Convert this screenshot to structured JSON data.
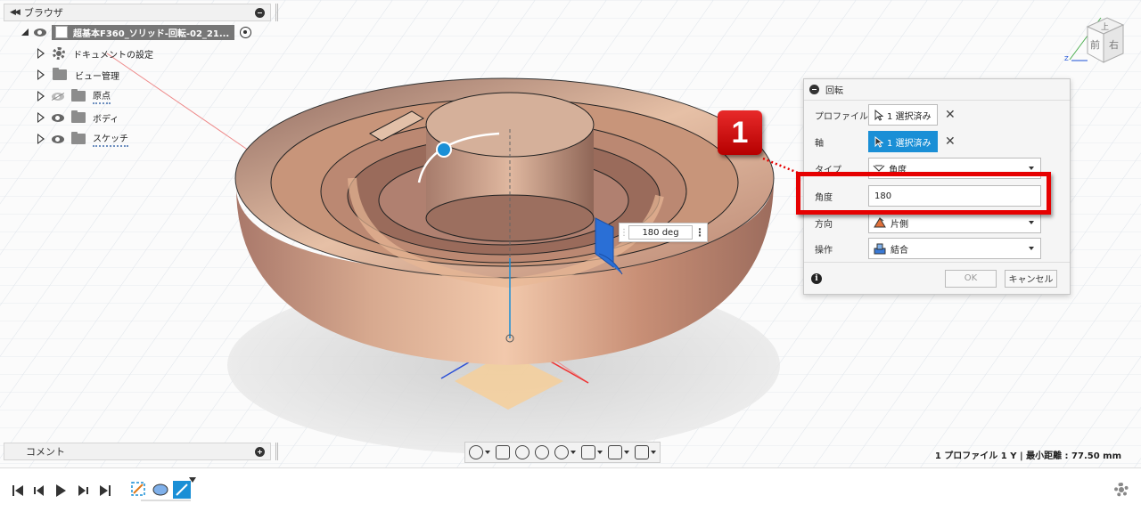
{
  "browser": {
    "title": "ブラウザ",
    "document_name": "超基本F360_ソリッド-回転-02_21...",
    "items": [
      {
        "label": "ドキュメントの設定",
        "icon": "gear-icon"
      },
      {
        "label": "ビュー管理",
        "icon": "folder-icon"
      },
      {
        "label": "原点",
        "icon": "folder-icon",
        "hidden": true
      },
      {
        "label": "ボディ",
        "icon": "folder-icon"
      },
      {
        "label": "スケッチ",
        "icon": "folder-icon"
      }
    ]
  },
  "comments": {
    "title": "コメント"
  },
  "viewcube": {
    "front_label": "前",
    "right_label": "右",
    "top_label": "上"
  },
  "dimension_input": {
    "value": "180 deg"
  },
  "dialog": {
    "title": "回転",
    "profile_label": "プロファイル",
    "profile_value": "1 選択済み",
    "axis_label": "軸",
    "axis_value": "1 選択済み",
    "type_label": "タイプ",
    "type_value": "角度",
    "angle_label": "角度",
    "angle_value": "180",
    "direction_label": "方向",
    "direction_value": "片側",
    "operation_label": "操作",
    "operation_value": "結合",
    "ok_label": "OK",
    "cancel_label": "キャンセル"
  },
  "annotation": {
    "step": "1",
    "color": "#e60000"
  },
  "status": {
    "text": "1 プロファイル 1 Y | 最小距離 : 77.50 mm"
  },
  "colors": {
    "accent": "#1a8fd6",
    "body": "#c8957a"
  }
}
